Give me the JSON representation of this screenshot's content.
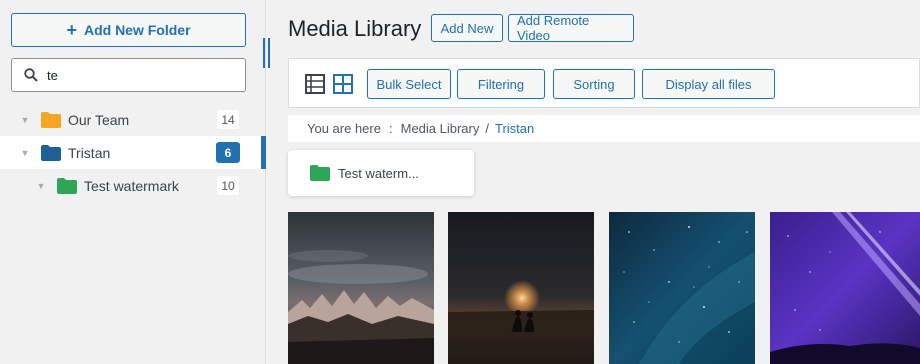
{
  "sidebar": {
    "add_folder_label": "Add New Folder",
    "search_value": "te",
    "folders": [
      {
        "name": "Our Team",
        "count": "14",
        "color": "#f5a623",
        "active": false
      },
      {
        "name": "Tristan",
        "count": "6",
        "color": "#2271b1",
        "active": true
      },
      {
        "name": "Test watermark",
        "count": "10",
        "color": "#2ea65a",
        "active": false
      }
    ]
  },
  "header": {
    "title": "Media Library",
    "add_new_label": "Add New",
    "add_remote_label": "Add Remote Video"
  },
  "toolbar": {
    "bulk_select_label": "Bulk Select",
    "filtering_label": "Filtering",
    "sorting_label": "Sorting",
    "display_all_label": "Display all files"
  },
  "breadcrumb": {
    "prefix": "You are here",
    "separator": ":",
    "root": "Media Library",
    "divider": "/",
    "current": "Tristan"
  },
  "subfolder": {
    "name": "Test waterm..."
  },
  "icons": {
    "search": "search-icon",
    "list_view": "list-view-icon",
    "grid_view": "grid-view-icon",
    "folder": "folder-icon",
    "caret": "caret-down-icon"
  },
  "colors": {
    "accent": "#2271b1",
    "folder_orange": "#f5a623",
    "folder_blue": "#2271b1",
    "folder_green": "#2ea65a"
  }
}
